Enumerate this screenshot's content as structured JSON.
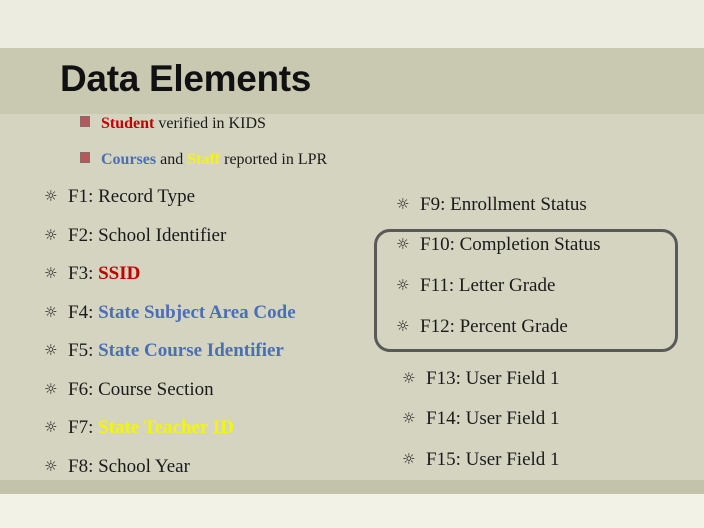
{
  "title": "Data Elements",
  "subs": [
    {
      "parts": [
        {
          "t": "Student",
          "c": "red"
        },
        {
          "t": " verified in KIDS",
          "c": ""
        }
      ]
    },
    {
      "parts": [
        {
          "t": "Courses",
          "c": "blue"
        },
        {
          "t": " and ",
          "c": ""
        },
        {
          "t": "Staff",
          "c": "yellow"
        },
        {
          "t": " reported in LPR",
          "c": ""
        }
      ]
    }
  ],
  "left": [
    {
      "prefix": "F1: ",
      "label": "Record Type",
      "style": ""
    },
    {
      "prefix": "F2: ",
      "label": "School Identifier",
      "style": ""
    },
    {
      "prefix": "F3: ",
      "label": "SSID",
      "style": "red"
    },
    {
      "prefix": "F4: ",
      "label": "State Subject Area Code",
      "style": "blue"
    },
    {
      "prefix": "F5: ",
      "label": "State Course Identifier",
      "style": "blue"
    },
    {
      "prefix": "F6: ",
      "label": "Course Section",
      "style": ""
    },
    {
      "prefix": "F7: ",
      "label": "State Teacher ID",
      "style": "yellow"
    },
    {
      "prefix": "F8: ",
      "label": "School Year",
      "style": ""
    }
  ],
  "right": [
    {
      "prefix": "F9: ",
      "label": "Enrollment Status",
      "style": ""
    },
    {
      "prefix": "F10: ",
      "label": "Completion Status",
      "style": ""
    },
    {
      "prefix": "F11: ",
      "label": "Letter Grade",
      "style": ""
    },
    {
      "prefix": "F12: ",
      "label": "Percent Grade",
      "style": ""
    },
    {
      "prefix": "F13: ",
      "label": "User Field 1",
      "style": ""
    },
    {
      "prefix": "F14: ",
      "label": "User Field 1",
      "style": ""
    },
    {
      "prefix": "F15: ",
      "label": "User Field 1",
      "style": ""
    }
  ],
  "bullet_icon": "star-outline-icon",
  "colors": {
    "red": "#c00000",
    "blue": "#4a6fb5",
    "yellow": "#f5f50a"
  }
}
